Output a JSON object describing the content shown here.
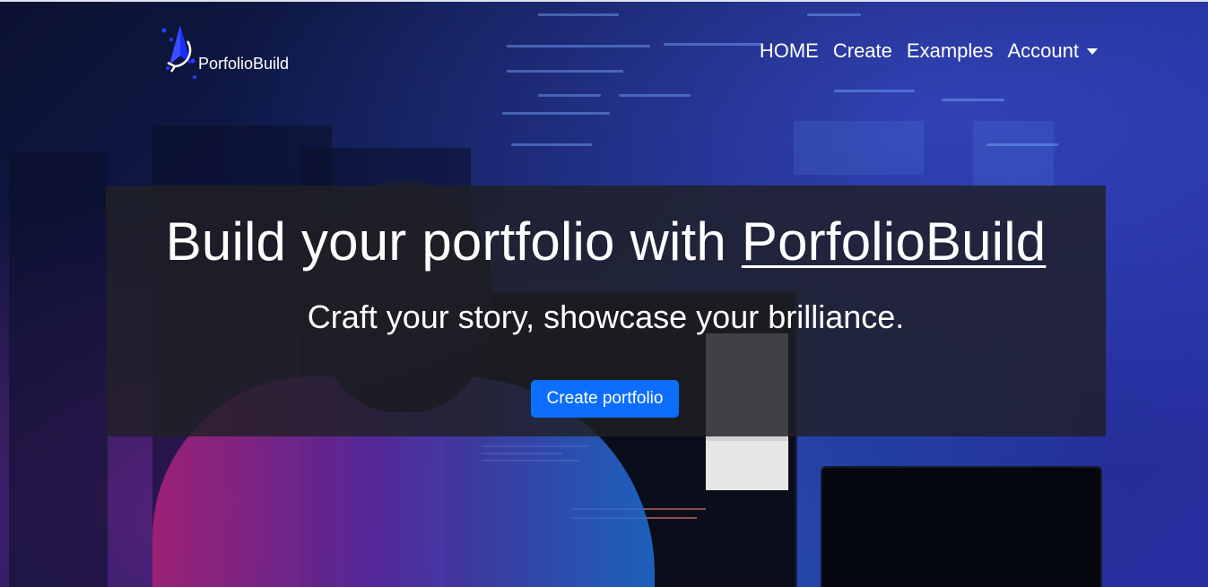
{
  "navbar": {
    "brand_name": "PorfolioBuild",
    "links": [
      {
        "label": "HOME"
      },
      {
        "label": "Create"
      },
      {
        "label": "Examples"
      },
      {
        "label": "Account"
      }
    ]
  },
  "hero": {
    "headline_prefix": "Build your portfolio with ",
    "headline_brand": "PorfolioBuild",
    "tagline": "Craft your story, showcase your brilliance.",
    "cta_label": "Create portfolio"
  },
  "colors": {
    "primary_button": "#0d6efd",
    "overlay": "#202024",
    "text": "#ffffff"
  },
  "icons": {
    "brand_logo": "compass-arrow-logo",
    "account_dropdown": "caret-down-icon"
  }
}
